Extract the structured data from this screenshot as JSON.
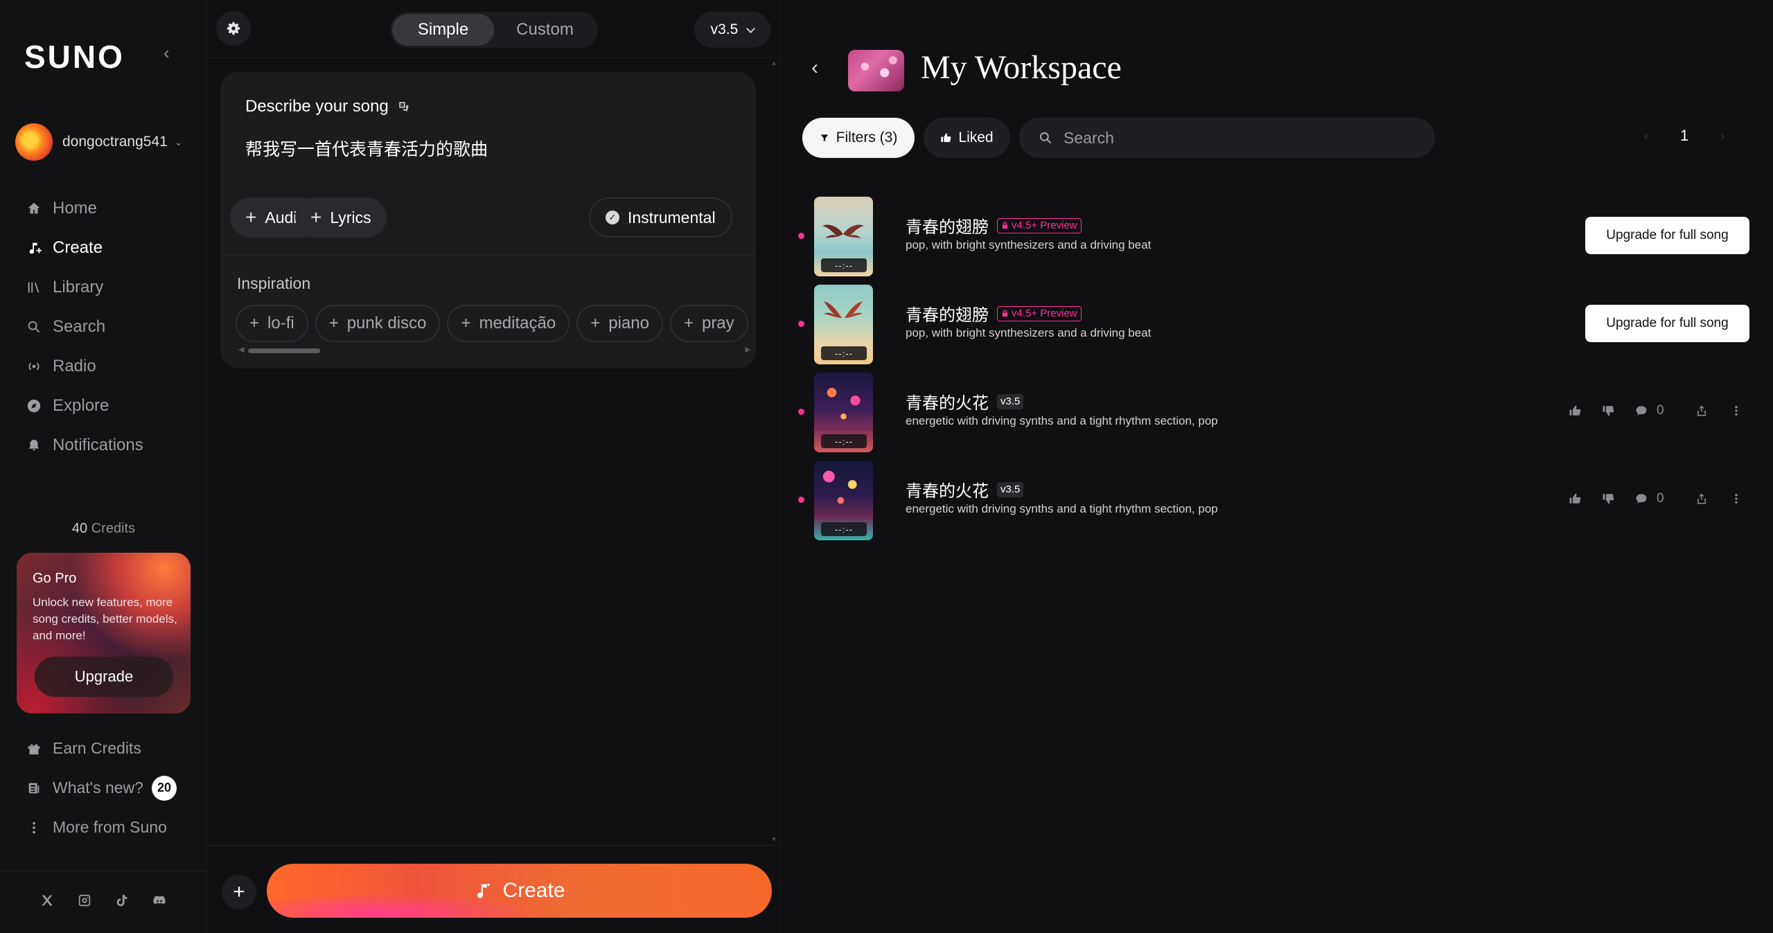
{
  "sidebar": {
    "logo": "SUNO",
    "username": "dongoctrang541",
    "nav": [
      {
        "label": "Home",
        "icon": "home-icon"
      },
      {
        "label": "Create",
        "icon": "create-music-icon"
      },
      {
        "label": "Library",
        "icon": "library-icon"
      },
      {
        "label": "Search",
        "icon": "search-icon"
      },
      {
        "label": "Radio",
        "icon": "radio-icon"
      },
      {
        "label": "Explore",
        "icon": "explore-icon"
      },
      {
        "label": "Notifications",
        "icon": "bell-icon"
      }
    ],
    "credits_number": "40",
    "credits_label": "Credits",
    "gopro": {
      "title": "Go Pro",
      "text": "Unlock new features, more song credits, better models, and more!",
      "button": "Upgrade"
    },
    "bottom": {
      "earn_credits": "Earn Credits",
      "whats_new": "What's new?",
      "whats_new_count": "20",
      "more_from_suno": "More from Suno"
    },
    "socials": [
      "x-icon",
      "instagram-icon",
      "tiktok-icon",
      "discord-icon"
    ]
  },
  "create_panel": {
    "modes": [
      "Simple",
      "Custom"
    ],
    "active_mode": "Simple",
    "version": "v3.5",
    "describe_label": "Describe your song",
    "prompt": "帮我写一首代表青春活力的歌曲",
    "add_audio": "Audio",
    "add_lyrics": "Lyrics",
    "instrumental": "Instrumental",
    "inspiration_label": "Inspiration",
    "inspiration_chips": [
      "lo-fi",
      "punk disco",
      "meditação",
      "piano",
      "pray"
    ],
    "create_button": "Create"
  },
  "workspace": {
    "title": "My Workspace",
    "filters_label": "Filters (3)",
    "liked_label": "Liked",
    "search_placeholder": "Search",
    "page": "1",
    "songs": [
      {
        "title": "青春的翅膀",
        "tag": "v4.5+ Preview",
        "tag_type": "preview",
        "desc": "pop, with bright synthesizers and a driving beat",
        "duration": "--:--",
        "action": "Upgrade for full song",
        "art": "wings"
      },
      {
        "title": "青春的翅膀",
        "tag": "v4.5+ Preview",
        "tag_type": "preview",
        "desc": "pop, with bright synthesizers and a driving beat",
        "duration": "--:--",
        "action": "Upgrade for full song",
        "art": "wings"
      },
      {
        "title": "青春的火花",
        "tag": "v3.5",
        "tag_type": "version",
        "desc": "energetic with driving synths and a tight rhythm section, pop",
        "duration": "--:--",
        "comments": "0",
        "art": "fireworks"
      },
      {
        "title": "青春的火花",
        "tag": "v3.5",
        "tag_type": "version",
        "desc": "energetic with driving synths and a tight rhythm section, pop",
        "duration": "--:--",
        "comments": "0",
        "art": "fireworks"
      }
    ]
  },
  "colors": {
    "accent_pink": "#ff2f9b",
    "create_gradient_start": "#ff6a2b",
    "background": "#101012"
  }
}
